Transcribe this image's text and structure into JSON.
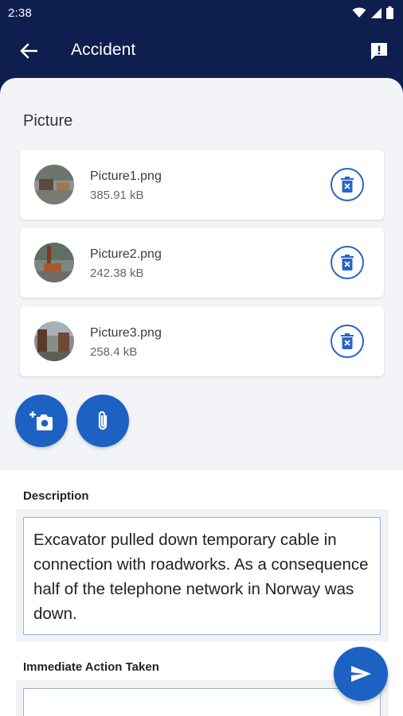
{
  "status_bar": {
    "time": "2:38",
    "icons": [
      "wifi-icon",
      "signal-icon",
      "battery-icon"
    ]
  },
  "app_bar": {
    "title": "Accident",
    "back_icon": "arrow-left-icon",
    "action_icon": "feedback-icon"
  },
  "pictures": {
    "section_title": "Picture",
    "items": [
      {
        "name": "Picture1.png",
        "size": "385.91 kB"
      },
      {
        "name": "Picture2.png",
        "size": "242.38 kB"
      },
      {
        "name": "Picture3.png",
        "size": "258.4 kB"
      }
    ],
    "delete_icon": "delete-icon",
    "camera_icon": "add-camera-icon",
    "attach_icon": "paperclip-icon"
  },
  "description": {
    "label": "Description",
    "value": "Excavator pulled down temporary cable in connection with roadworks. As a consequence half of the telephone network in Norway was down."
  },
  "immediate_action": {
    "label": "Immediate Action Taken",
    "value": ""
  },
  "send_icon": "send-icon",
  "colors": {
    "header": "#0e1e4f",
    "accent": "#1d62c3",
    "sheet": "#f3f4f7"
  }
}
